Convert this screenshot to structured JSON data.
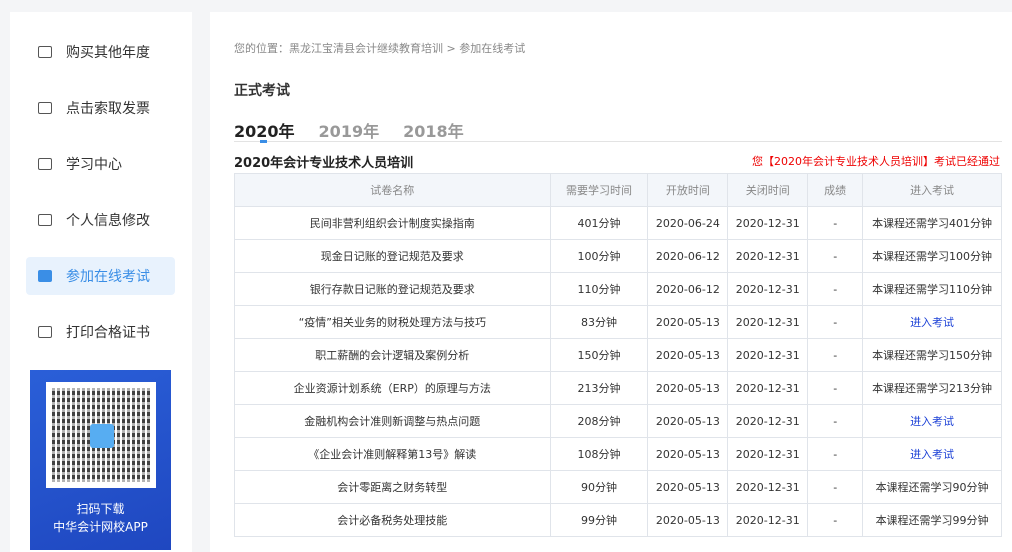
{
  "sidebar": {
    "items": [
      {
        "label": "购买其他年度",
        "icon": "calendar-icon"
      },
      {
        "label": "点击索取发票",
        "icon": "invoice-icon"
      },
      {
        "label": "学习中心",
        "icon": "monitor-icon"
      },
      {
        "label": "个人信息修改",
        "icon": "user-icon"
      },
      {
        "label": "参加在线考试",
        "icon": "bookmark-icon",
        "active": true
      },
      {
        "label": "打印合格证书",
        "icon": "printer-icon"
      }
    ],
    "qr": {
      "line1": "扫码下载",
      "line2": "中华会计网校APP"
    }
  },
  "breadcrumb": "您的位置：黑龙江宝清县会计继续教育培训 > 参加在线考试",
  "title": "正式考试",
  "tabs": [
    "2020年",
    "2019年",
    "2018年"
  ],
  "section_title": "2020年会计专业技术人员培训",
  "pass_notice": "您【2020年会计专业技术人员培训】考试已经通过",
  "table": {
    "headers": [
      "试卷名称",
      "需要学习时间",
      "开放时间",
      "关闭时间",
      "成绩",
      "进入考试"
    ],
    "rows": [
      [
        "民间非营利组织会计制度实操指南",
        "401分钟",
        "2020-06-24",
        "2020-12-31",
        "-",
        "本课程还需学习401分钟"
      ],
      [
        "现金日记账的登记规范及要求",
        "100分钟",
        "2020-06-12",
        "2020-12-31",
        "-",
        "本课程还需学习100分钟"
      ],
      [
        "银行存款日记账的登记规范及要求",
        "110分钟",
        "2020-06-12",
        "2020-12-31",
        "-",
        "本课程还需学习110分钟"
      ],
      [
        "“疫情”相关业务的财税处理方法与技巧",
        "83分钟",
        "2020-05-13",
        "2020-12-31",
        "-",
        "进入考试"
      ],
      [
        "职工薪酬的会计逻辑及案例分析",
        "150分钟",
        "2020-05-13",
        "2020-12-31",
        "-",
        "本课程还需学习150分钟"
      ],
      [
        "企业资源计划系统（ERP）的原理与方法",
        "213分钟",
        "2020-05-13",
        "2020-12-31",
        "-",
        "本课程还需学习213分钟"
      ],
      [
        "金融机构会计准则新调整与热点问题",
        "208分钟",
        "2020-05-13",
        "2020-12-31",
        "-",
        "进入考试"
      ],
      [
        "《企业会计准则解释第13号》解读",
        "108分钟",
        "2020-05-13",
        "2020-12-31",
        "-",
        "进入考试"
      ],
      [
        "会计零距离之财务转型",
        "90分钟",
        "2020-05-13",
        "2020-12-31",
        "-",
        "本课程还需学习90分钟"
      ],
      [
        "会计必备税务处理技能",
        "99分钟",
        "2020-05-13",
        "2020-12-31",
        "-",
        "本课程还需学习99分钟"
      ]
    ]
  }
}
